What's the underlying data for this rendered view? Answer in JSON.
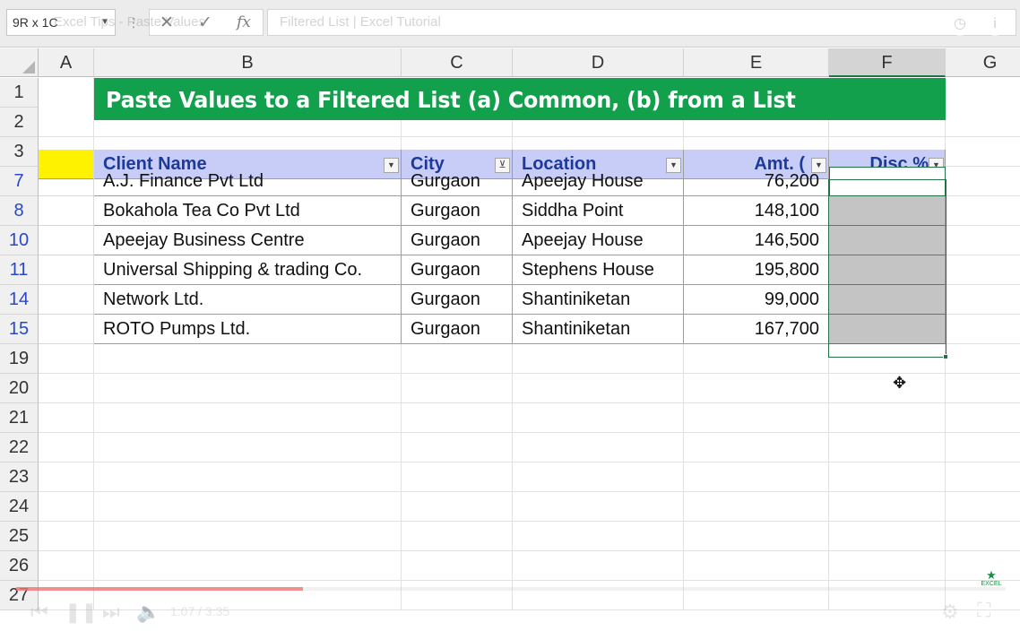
{
  "formula_bar": {
    "name_box": "9R x 1C",
    "cancel_icon": "✕",
    "enter_icon": "✓",
    "function_icon": "fx",
    "overlay_title_left": "Excel Tips - Paste Values",
    "overlay_title_right": "Filtered List | Excel Tutorial"
  },
  "columns": [
    {
      "letter": "A"
    },
    {
      "letter": "B"
    },
    {
      "letter": "C"
    },
    {
      "letter": "D"
    },
    {
      "letter": "E"
    },
    {
      "letter": "F"
    },
    {
      "letter": "G"
    }
  ],
  "row_numbers": [
    "1",
    "2",
    "3",
    "7",
    "8",
    "10",
    "11",
    "14",
    "15",
    "19",
    "20",
    "21",
    "22",
    "23",
    "24",
    "25",
    "26",
    "27"
  ],
  "title": "Paste Values to a Filtered List (a) Common, (b) from a List",
  "table": {
    "headers": [
      "Client Name",
      "City",
      "Location",
      "Amt. (",
      "Disc %"
    ],
    "rows": [
      [
        "A.J. Finance Pvt Ltd",
        "Gurgaon",
        "Apeejay House",
        "76,200"
      ],
      [
        "Bokahola Tea Co Pvt Ltd",
        "Gurgaon",
        "Siddha Point",
        "148,100"
      ],
      [
        "Apeejay Business Centre",
        "Gurgaon",
        "Apeejay House",
        "146,500"
      ],
      [
        "Universal Shipping & trading Co.",
        "Gurgaon",
        "Stephens House",
        "195,800"
      ],
      [
        "Network Ltd.",
        "Gurgaon",
        "Shantiniketan",
        "99,000"
      ],
      [
        "ROTO Pumps Ltd.",
        "Gurgaon",
        "Shantiniketan",
        "167,700"
      ]
    ]
  },
  "video": {
    "time": "1:07 / 3:35",
    "progress": 0.29
  },
  "logo": {
    "text": "EXCEL"
  },
  "colors": {
    "title_band": "#13a04c",
    "header_fill": "#c8cdf8",
    "header_text": "#1d3a9a",
    "marker_fill": "#fff200",
    "selection_fill": "#c4c4c4",
    "selection_border": "#217346",
    "filtered_row_number": "#2a47c7"
  },
  "icons": {
    "filter_dropdown": "chevron-down-icon",
    "filter_active": "funnel-icon",
    "cursor": "cross-cursor-icon"
  }
}
